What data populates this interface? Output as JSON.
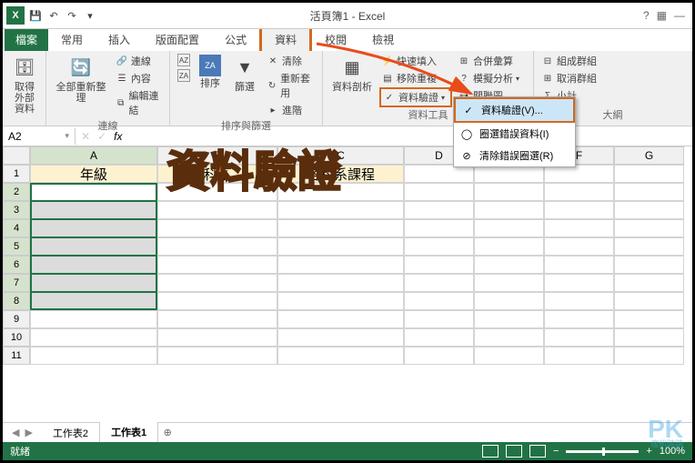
{
  "window": {
    "title": "活頁簿1 - Excel"
  },
  "ribbon": {
    "file": "檔案",
    "tabs": [
      "常用",
      "插入",
      "版面配置",
      "公式",
      "資料",
      "校閱",
      "檢視"
    ],
    "active": "資料",
    "groups": {
      "external": {
        "btn": "取得外部\n資料",
        "label": ""
      },
      "connections": {
        "refresh": "全部重新整理",
        "conn": "連線",
        "props": "內容",
        "editlinks": "編輯連結",
        "label": "連線"
      },
      "sort": {
        "az": "A↓Z",
        "za": "Z↓A",
        "sort": "排序",
        "filter": "篩選",
        "clear": "清除",
        "reapply": "重新套用",
        "advanced": "進階",
        "label": "排序與篩選"
      },
      "tools": {
        "t2c": "資料剖析",
        "flash": "快速填入",
        "dupe": "移除重複",
        "validation": "資料驗證",
        "consolidate": "合併彙算",
        "whatif": "模擬分析",
        "relations": "關聯圖",
        "label": "資料工具"
      },
      "outline": {
        "group": "組成群組",
        "ungroup": "取消群組",
        "subtotal": "小計",
        "label": "大綱"
      }
    }
  },
  "dropdown": {
    "items": [
      {
        "label": "資料驗證(V)...",
        "hl": true
      },
      {
        "label": "圈選錯誤資料(I)",
        "hl": false
      },
      {
        "label": "清除錯誤圈選(R)",
        "hl": false
      }
    ]
  },
  "formula": {
    "name_box": "A2",
    "fx": "fx"
  },
  "columns": [
    "A",
    "B",
    "C",
    "D",
    "E",
    "F",
    "G"
  ],
  "headers": {
    "A": "年級",
    "B": "科系",
    "C": "各科系課程"
  },
  "overlay_text": "資料驗證",
  "sheets": {
    "tabs": [
      "工作表2",
      "工作表1"
    ],
    "active": "工作表1"
  },
  "status": {
    "ready": "就緒",
    "zoom": "100%"
  },
  "watermark": {
    "main": "PK",
    "sub": "痞凱踏踏"
  }
}
